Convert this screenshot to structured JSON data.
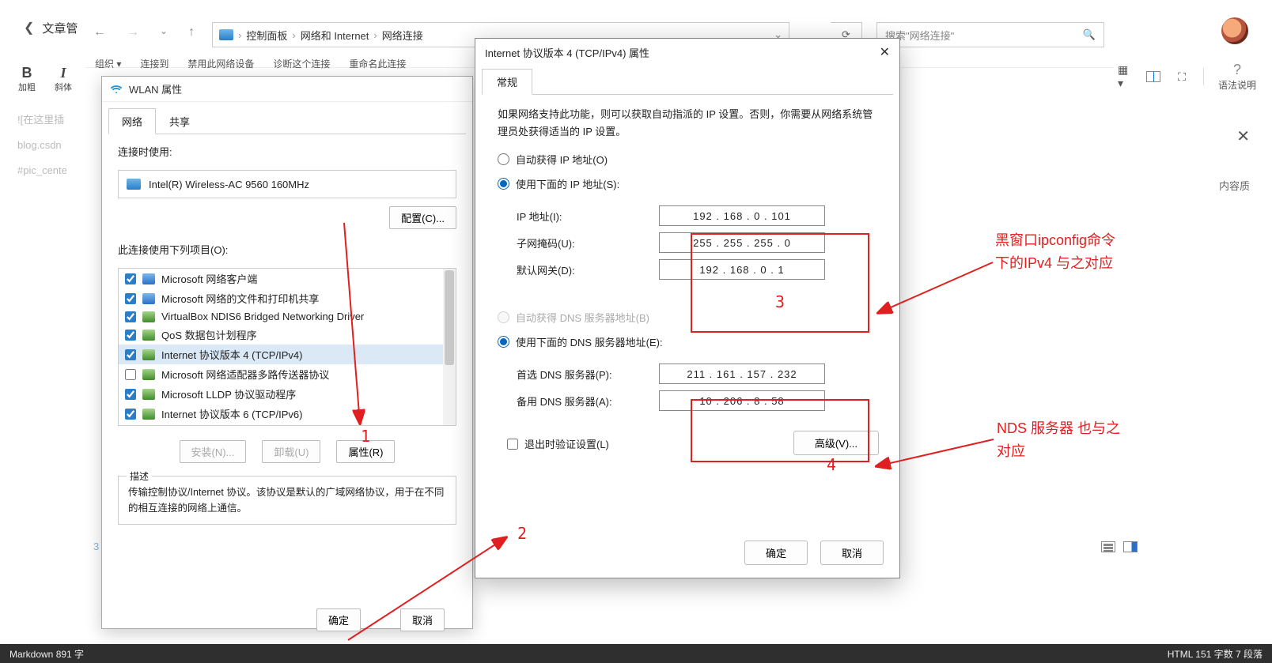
{
  "editor": {
    "back_label": "文章管",
    "tool_bold": "加粗",
    "tool_italic": "斜体",
    "grammar": "语法说明",
    "sidebar_right": "内容质",
    "bg_lines": [
      "![在这里插",
      "blog.csdn",
      "#pic_cente"
    ],
    "page_num": "3"
  },
  "explorer": {
    "crumb": [
      "控制面板",
      "网络和 Internet",
      "网络连接"
    ],
    "search_placeholder": "搜索\"网络连接\"",
    "cmds": [
      "组织 ▾",
      "连接到",
      "禁用此网络设备",
      "诊断这个连接",
      "重命名此连接"
    ]
  },
  "wlan": {
    "title": "WLAN 属性",
    "tab_net": "网络",
    "tab_share": "共享",
    "connect_using": "连接时使用:",
    "adapter": "Intel(R) Wireless-AC 9560 160MHz",
    "configure": "配置(C)...",
    "uses_items": "此连接使用下列项目(O):",
    "items": [
      {
        "c": true,
        "t": "Microsoft 网络客户端",
        "blue": true
      },
      {
        "c": true,
        "t": "Microsoft 网络的文件和打印机共享",
        "blue": true
      },
      {
        "c": true,
        "t": "VirtualBox NDIS6 Bridged Networking Driver",
        "blue": false
      },
      {
        "c": true,
        "t": "QoS 数据包计划程序",
        "blue": false
      },
      {
        "c": true,
        "t": "Internet 协议版本 4 (TCP/IPv4)",
        "blue": false,
        "sel": true
      },
      {
        "c": false,
        "t": "Microsoft 网络适配器多路传送器协议",
        "blue": false
      },
      {
        "c": true,
        "t": "Microsoft LLDP 协议驱动程序",
        "blue": false
      },
      {
        "c": true,
        "t": "Internet 协议版本 6 (TCP/IPv6)",
        "blue": false
      }
    ],
    "install": "安装(N)...",
    "uninstall": "卸载(U)",
    "properties": "属性(R)",
    "desc_label": "描述",
    "desc_text": "传输控制协议/Internet 协议。该协议是默认的广域网络协议，用于在不同的相互连接的网络上通信。",
    "ok": "确定",
    "cancel": "取消"
  },
  "ipv4": {
    "title": "Internet 协议版本 4 (TCP/IPv4) 属性",
    "tab": "常规",
    "intro": "如果网络支持此功能，则可以获取自动指派的 IP 设置。否则，你需要从网络系统管理员处获得适当的 IP 设置。",
    "auto_ip": "自动获得 IP 地址(O)",
    "manual_ip": "使用下面的 IP 地址(S):",
    "ip_label": "IP 地址(I):",
    "ip_value": "192 . 168 .  0  . 101",
    "mask_label": "子网掩码(U):",
    "mask_value": "255 . 255 . 255 .  0",
    "gw_label": "默认网关(D):",
    "gw_value": "192 . 168 .  0  .  1",
    "auto_dns": "自动获得 DNS 服务器地址(B)",
    "manual_dns": "使用下面的 DNS 服务器地址(E):",
    "dns1_label": "首选 DNS 服务器(P):",
    "dns1_value": "211 . 161 . 157 . 232",
    "dns2_label": "备用 DNS 服务器(A):",
    "dns2_value": "10  . 206 .  8  .  58",
    "exit_check": "退出时验证设置(L)",
    "advanced": "高级(V)...",
    "ok": "确定",
    "cancel": "取消"
  },
  "anno": {
    "n1": "1",
    "n2": "2",
    "n3": "3",
    "n4": "4",
    "r1a": "黑窗口ipconfig命令",
    "r1b": "下的IPv4 与之对应",
    "r2a": "NDS 服务器 也与之",
    "r2b": "对应"
  },
  "status": {
    "left": "Markdown  891 字",
    "right": "HTML  151 字数   7 段落"
  }
}
